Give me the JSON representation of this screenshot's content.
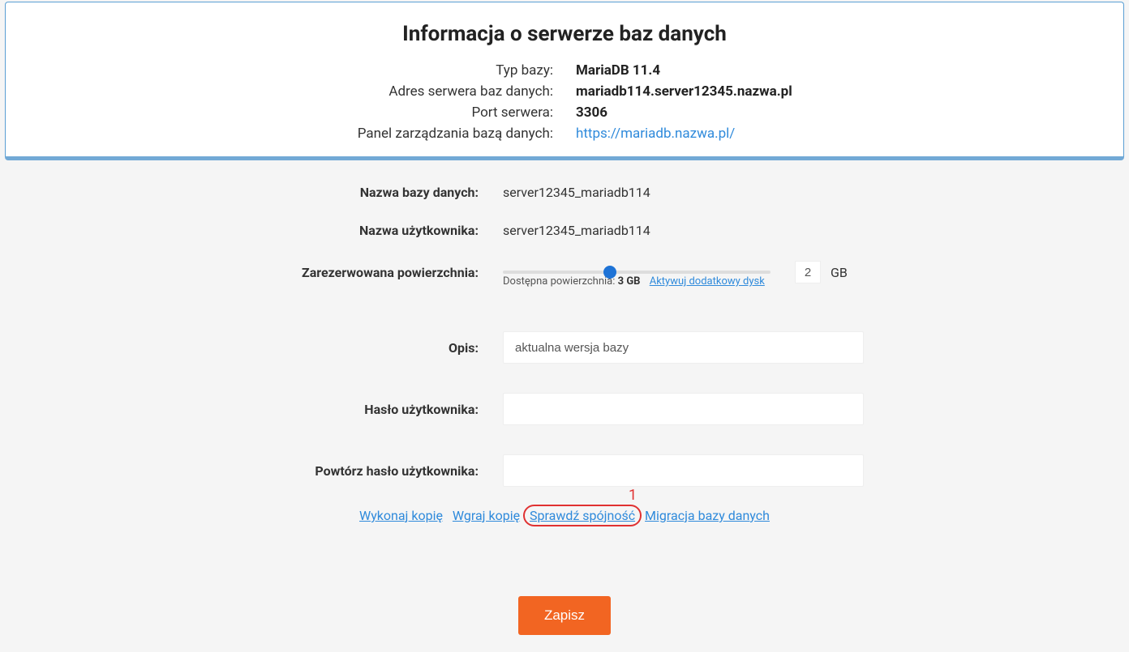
{
  "info": {
    "title": "Informacja o serwerze baz danych",
    "rows": {
      "db_type_label": "Typ bazy:",
      "db_type_value": "MariaDB 11.4",
      "db_addr_label": "Adres serwera baz danych:",
      "db_addr_value": "mariadb114.server12345.nazwa.pl",
      "db_port_label": "Port serwera:",
      "db_port_value": "3306",
      "db_panel_label": "Panel zarządzania bazą danych:",
      "db_panel_url": "https://mariadb.nazwa.pl/"
    }
  },
  "form": {
    "db_name_label": "Nazwa bazy danych:",
    "db_name_value": "server12345_mariadb114",
    "user_label": "Nazwa użytkownika:",
    "user_value": "server12345_mariadb114",
    "reserved_label": "Zarezerwowana powierzchnia:",
    "reserved_value": "2",
    "reserved_unit": "GB",
    "available_prefix": "Dostępna powierzchnia: ",
    "available_value": "3 GB",
    "activate_disk_link": "Aktywuj dodatkowy dysk",
    "desc_label": "Opis:",
    "desc_value": "aktualna wersja bazy",
    "pass_label": "Hasło użytkownika:",
    "pass2_label": "Powtórz hasło użytkownika:"
  },
  "links": {
    "make_copy": "Wykonaj kopię",
    "upload_copy": "Wgraj kopię",
    "check_integrity": "Sprawdź spójność",
    "migrate_db": "Migracja bazy danych"
  },
  "annotation": {
    "number": "1"
  },
  "buttons": {
    "save": "Zapisz"
  }
}
